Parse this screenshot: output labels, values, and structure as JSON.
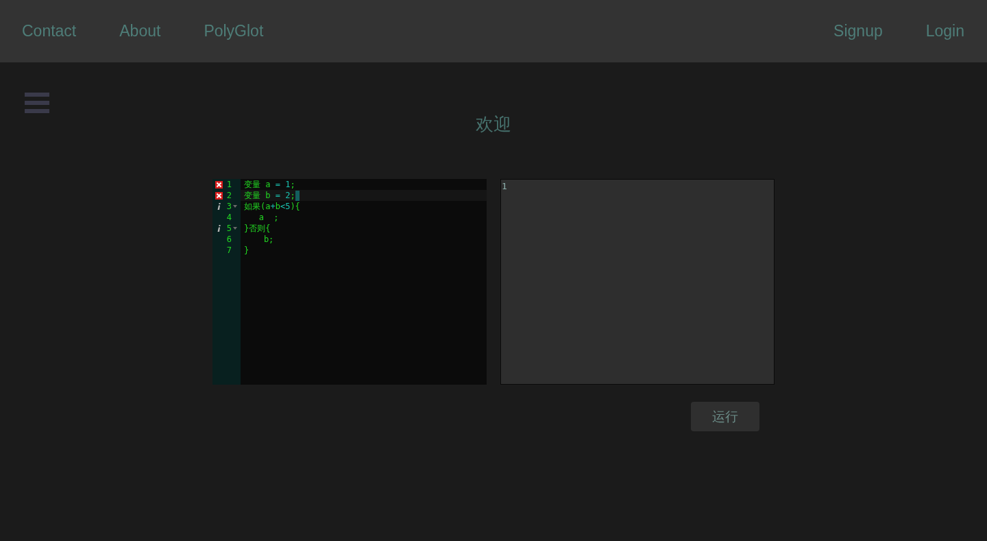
{
  "nav": {
    "left_links": [
      {
        "label": "Contact"
      },
      {
        "label": "About"
      },
      {
        "label": "PolyGlot"
      }
    ],
    "right_links": [
      {
        "label": "Signup"
      },
      {
        "label": "Login"
      }
    ]
  },
  "heading": "欢迎",
  "editor": {
    "lines": [
      {
        "number": "1",
        "code": "变量 a = 1;",
        "error": true,
        "info": false,
        "foldable": false,
        "active": false
      },
      {
        "number": "2",
        "code": "变量 b = 2;",
        "error": true,
        "info": false,
        "foldable": false,
        "active": true
      },
      {
        "number": "3",
        "code": "如果(a+b<5){",
        "error": false,
        "info": true,
        "foldable": true,
        "active": false
      },
      {
        "number": "4",
        "code": "   a  ;",
        "error": false,
        "info": false,
        "foldable": false,
        "active": false
      },
      {
        "number": "5",
        "code": "}否则{",
        "error": false,
        "info": true,
        "foldable": true,
        "active": false
      },
      {
        "number": "6",
        "code": "    b;",
        "error": false,
        "info": false,
        "foldable": false,
        "active": false
      },
      {
        "number": "7",
        "code": "}",
        "error": false,
        "info": false,
        "foldable": false,
        "active": false
      }
    ]
  },
  "output": {
    "value": "1"
  },
  "run_button": {
    "label": "运行"
  }
}
